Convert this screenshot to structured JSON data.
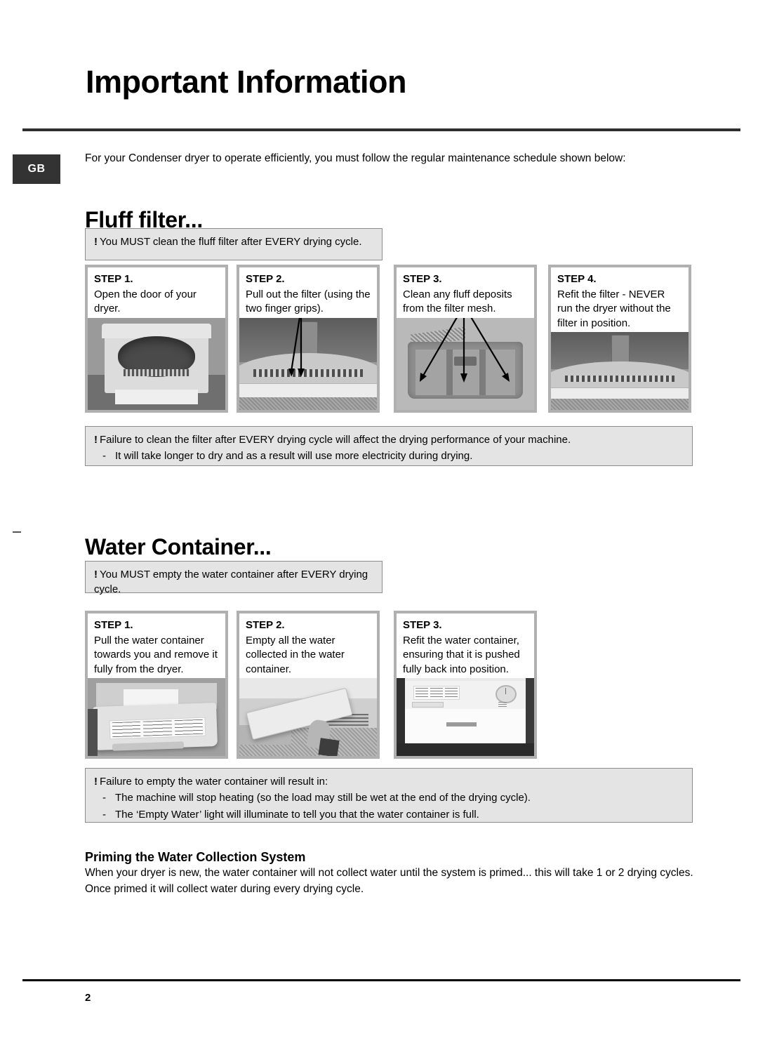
{
  "document": {
    "title": "Important Information",
    "locale_badge": "GB",
    "intro": "For your Condenser dryer to operate efficiently, you must follow the regular maintenance schedule shown below:",
    "page_number": "2"
  },
  "fluff_section": {
    "heading": "Fluff filter...",
    "top_notice": {
      "bang": "!",
      "text": "You MUST clean the fluff filter after EVERY drying cycle."
    },
    "steps": [
      {
        "label": "STEP 1.",
        "text": "Open the door of your dryer.",
        "photo": "dryer-open-door-photo"
      },
      {
        "label": "STEP 2.",
        "text": "Pull out the filter (using the two finger grips).",
        "photo": "filter-finger-grips-photo"
      },
      {
        "label": "STEP 3.",
        "text": "Clean any fluff deposits from the filter mesh.",
        "photo": "filter-mesh-photo"
      },
      {
        "label": "STEP 4.",
        "text": "Refit the filter - NEVER run the dryer without the filter in position.",
        "photo": "filter-refit-photo"
      }
    ],
    "bottom_notice": {
      "bang": "!",
      "lead": "Failure to clean the filter after EVERY drying cycle will affect the drying performance of your machine.",
      "bullets": [
        "It will take longer to dry and as a result will use more electricity during drying."
      ],
      "dash": "-"
    }
  },
  "water_section": {
    "heading": "Water Container...",
    "top_notice": {
      "bang": "!",
      "text": "You MUST empty the water container after EVERY drying cycle."
    },
    "steps": [
      {
        "label": "STEP 1.",
        "text": "Pull the water container towards you and remove it fully from the dryer.",
        "photo": "water-container-removal-photo"
      },
      {
        "label": "STEP 2.",
        "text": "Empty all the water collected in the water container.",
        "photo": "water-container-emptying-photo"
      },
      {
        "label": "STEP 3.",
        "text": "Refit the water container, ensuring that it is pushed fully back into position.",
        "photo": "dryer-front-photo"
      }
    ],
    "bottom_notice": {
      "bang": "!",
      "lead": "Failure to empty the water container will result in:",
      "bullets": [
        "The machine will stop heating (so the load may still be wet at the end of the drying cycle).",
        "The ‘Empty Water’ light will illuminate to tell you that the water container is full."
      ],
      "dash": "-"
    },
    "priming": {
      "heading": "Priming the Water Collection System",
      "text": "When your dryer is new, the water container will not collect water until the system is primed... this will take 1 or 2 drying cycles. Once primed it will collect water during every drying cycle."
    }
  },
  "colors": {
    "badge_background": "#333333",
    "notice_background": "#e4e4e4",
    "notice_border": "#8c8c8c",
    "card_frame": "#b0b0b0",
    "rule": "#2e2e2e"
  }
}
